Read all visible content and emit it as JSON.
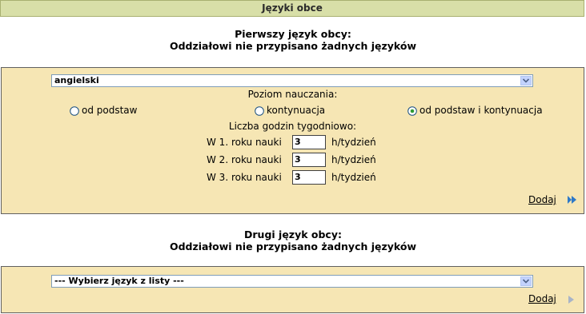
{
  "header": {
    "title": "Języki obce"
  },
  "section1": {
    "title_line1": "Pierwszy język obcy:",
    "title_line2": "Oddziałowi nie przypisano żadnych języków",
    "select_value": "angielski",
    "level_label": "Poziom nauczania:",
    "options": [
      {
        "label": "od podstaw",
        "selected": false
      },
      {
        "label": "kontynuacja",
        "selected": false
      },
      {
        "label": "od podstaw i kontynuacja",
        "selected": true
      }
    ],
    "hours_label": "Liczba godzin tygodniowo:",
    "years": [
      {
        "label": "W 1. roku nauki",
        "value": "3",
        "unit": "h/tydzień"
      },
      {
        "label": "W 2. roku nauki",
        "value": "3",
        "unit": "h/tydzień"
      },
      {
        "label": "W 3. roku nauki",
        "value": "3",
        "unit": "h/tydzień"
      }
    ],
    "add_label": "Dodaj"
  },
  "section2": {
    "title_line1": "Drugi język obcy:",
    "title_line2": "Oddziałowi nie przypisano żadnych języków",
    "select_placeholder": "--- Wybierz język z listy ---",
    "add_label": "Dodaj"
  },
  "colors": {
    "header_bg": "#d8dfa8",
    "panel_bg": "#f6e6b4",
    "arrow_active": "#2e79c8",
    "arrow_disabled": "#a8b4c8"
  }
}
